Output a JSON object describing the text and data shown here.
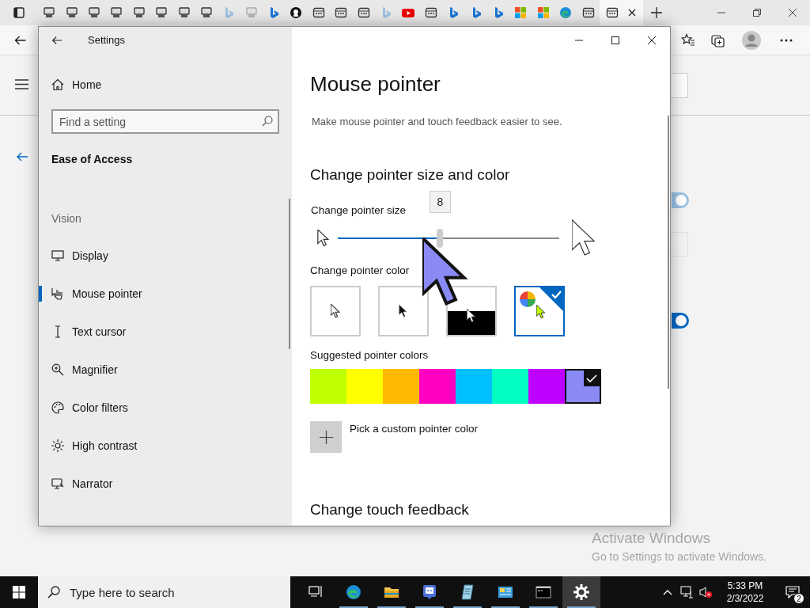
{
  "browser": {
    "tabs": [
      {
        "kind": "computer",
        "sleeping": false,
        "selected": false
      },
      {
        "kind": "computer",
        "sleeping": false,
        "selected": false
      },
      {
        "kind": "computer",
        "sleeping": false,
        "selected": false
      },
      {
        "kind": "computer",
        "sleeping": false,
        "selected": false
      },
      {
        "kind": "computer",
        "sleeping": false,
        "selected": false
      },
      {
        "kind": "computer",
        "sleeping": false,
        "selected": false
      },
      {
        "kind": "computer",
        "sleeping": false,
        "selected": false
      },
      {
        "kind": "computer",
        "sleeping": false,
        "selected": false
      },
      {
        "kind": "bing",
        "sleeping": true,
        "selected": false
      },
      {
        "kind": "computer",
        "sleeping": true,
        "selected": false
      },
      {
        "kind": "bing",
        "sleeping": false,
        "selected": false
      },
      {
        "kind": "github",
        "sleeping": false,
        "selected": false
      },
      {
        "kind": "page",
        "sleeping": false,
        "selected": false
      },
      {
        "kind": "page",
        "sleeping": false,
        "selected": false
      },
      {
        "kind": "page",
        "sleeping": false,
        "selected": false
      },
      {
        "kind": "bing",
        "sleeping": true,
        "selected": false
      },
      {
        "kind": "youtube",
        "sleeping": false,
        "selected": false
      },
      {
        "kind": "page",
        "sleeping": false,
        "selected": false
      },
      {
        "kind": "bing",
        "sleeping": false,
        "selected": false
      },
      {
        "kind": "bing",
        "sleeping": false,
        "selected": false
      },
      {
        "kind": "bing",
        "sleeping": false,
        "selected": false
      },
      {
        "kind": "windows",
        "sleeping": false,
        "selected": false
      },
      {
        "kind": "windows",
        "sleeping": false,
        "selected": false
      },
      {
        "kind": "edge",
        "sleeping": false,
        "selected": false
      },
      {
        "kind": "page",
        "sleeping": false,
        "selected": false
      },
      {
        "kind": "page",
        "sleeping": false,
        "selected": true
      }
    ],
    "page": {
      "toggles": [
        {
          "on": true,
          "disabled": true
        },
        {
          "on": true,
          "disabled": false
        }
      ]
    }
  },
  "settings": {
    "title": "Settings",
    "nav": {
      "home": "Home",
      "search_placeholder": "Find a setting",
      "section": "Ease of Access",
      "group": "Vision",
      "items": [
        {
          "label": "Display",
          "selected": false
        },
        {
          "label": "Mouse pointer",
          "selected": true
        },
        {
          "label": "Text cursor",
          "selected": false
        },
        {
          "label": "Magnifier",
          "selected": false
        },
        {
          "label": "Color filters",
          "selected": false
        },
        {
          "label": "High contrast",
          "selected": false
        },
        {
          "label": "Narrator",
          "selected": false
        }
      ]
    },
    "page": {
      "title": "Mouse pointer",
      "description": "Make mouse pointer and touch feedback easier to see.",
      "heading": "Change pointer size and color",
      "size_label": "Change pointer size",
      "size_value": "8",
      "size_slider": {
        "level": 0.46
      },
      "color_label": "Change pointer color",
      "color_options": [
        {
          "kind": "white",
          "selected": false
        },
        {
          "kind": "black",
          "selected": false
        },
        {
          "kind": "inverted",
          "selected": false
        },
        {
          "kind": "custom",
          "selected": true
        }
      ],
      "suggested_label": "Suggested pointer colors",
      "suggested": [
        {
          "color": "#c0ff00",
          "selected": false
        },
        {
          "color": "#ffff00",
          "selected": false
        },
        {
          "color": "#ffba00",
          "selected": false
        },
        {
          "color": "#ff00c0",
          "selected": false
        },
        {
          "color": "#00c0ff",
          "selected": false
        },
        {
          "color": "#00ffc0",
          "selected": false
        },
        {
          "color": "#c000ff",
          "selected": false
        },
        {
          "color": "#8a8af5",
          "selected": true
        }
      ],
      "custom_label": "Pick a custom pointer color",
      "next_heading": "Change touch feedback"
    }
  },
  "activation_notice": {
    "title": "Activate Windows",
    "subtitle": "Go to Settings to activate Windows."
  },
  "taskbar": {
    "search_placeholder": "Type here to search",
    "apps": [
      {
        "kind": "task-view",
        "running": false,
        "selected": false
      },
      {
        "kind": "edge",
        "running": true,
        "selected": false
      },
      {
        "kind": "folder",
        "running": true,
        "selected": false
      },
      {
        "kind": "chat",
        "running": true,
        "selected": false
      },
      {
        "kind": "notepad",
        "running": true,
        "selected": false
      },
      {
        "kind": "control-panel",
        "running": true,
        "selected": false
      },
      {
        "kind": "terminal",
        "running": true,
        "selected": false
      },
      {
        "kind": "settings",
        "running": true,
        "selected": true
      }
    ],
    "time": "5:33 PM",
    "date": "2/3/2022",
    "notification_count": "2"
  }
}
